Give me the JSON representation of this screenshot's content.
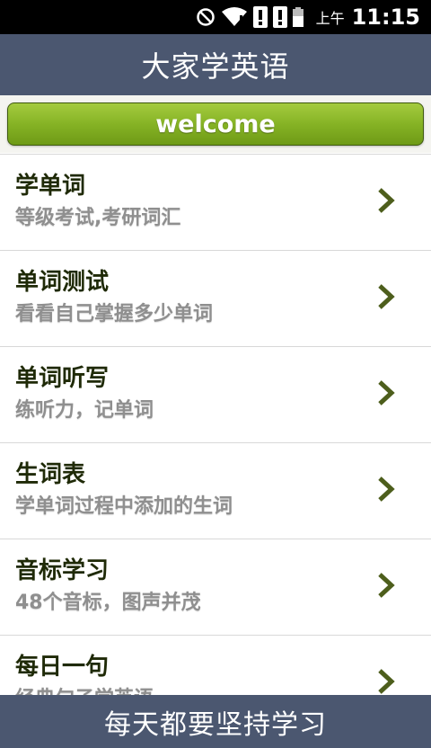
{
  "status_bar": {
    "ampm": "上午",
    "time": "11:15",
    "icons": [
      "do-not-disturb-icon",
      "wifi-icon",
      "alert-icon",
      "alert-icon",
      "battery-icon"
    ]
  },
  "app": {
    "title": "大家学英语",
    "welcome_label": "welcome",
    "footer_text": "每天都要坚持学习"
  },
  "menu": [
    {
      "title": "学单词",
      "subtitle": "等级考试,考研词汇"
    },
    {
      "title": "单词测试",
      "subtitle": "看看自己掌握多少单词"
    },
    {
      "title": "单词听写",
      "subtitle": "练听力，记单词"
    },
    {
      "title": "生词表",
      "subtitle": "学单词过程中添加的生词"
    },
    {
      "title": "音标学习",
      "subtitle": "48个音标，图声并茂"
    },
    {
      "title": "每日一句",
      "subtitle": "经典句子学英语"
    }
  ],
  "colors": {
    "header": "#4b5770",
    "welcome_green": "#86b325",
    "arrow": "#4d5e1c"
  }
}
